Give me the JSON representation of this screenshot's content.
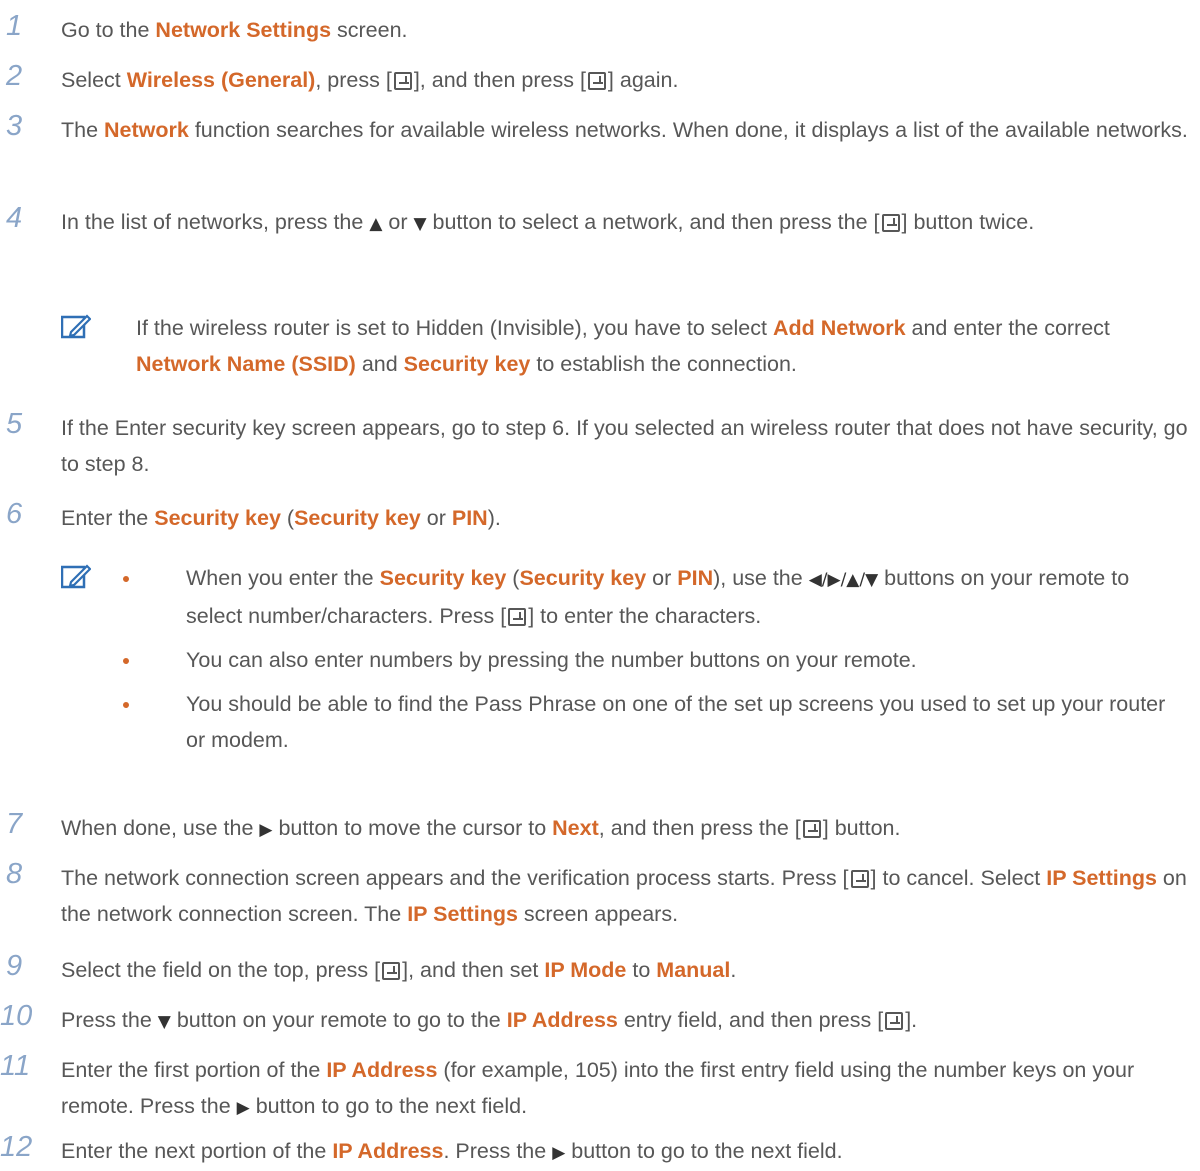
{
  "steps": [
    {
      "n": "1",
      "parts": [
        "Go to the ",
        "Network Settings",
        " screen."
      ]
    },
    {
      "n": "2",
      "parts": [
        "Select ",
        "Wireless (General)",
        ", press [",
        "], and then press [",
        "] again."
      ]
    },
    {
      "n": "3",
      "parts": [
        "The ",
        "Network",
        " function searches for available wireless networks. When done, it displays a list of the available networks."
      ]
    },
    {
      "n": "4",
      "parts": [
        "In the list of networks, press the ",
        "▲",
        " or ",
        "▼",
        " button to select a network, and then press the [",
        "] button twice."
      ]
    },
    {
      "n": "5",
      "parts": [
        "If the Enter security key screen appears, go to step 6. If you selected an wireless router that does not have security, go to step 8."
      ]
    },
    {
      "n": "6",
      "parts": [
        "Enter the ",
        "Security key",
        " (",
        "Security key",
        " or ",
        "PIN",
        ")."
      ]
    },
    {
      "n": "7",
      "parts": [
        "When done, use the ",
        "▶",
        " button to move the cursor to ",
        "Next",
        ", and then press the [",
        "] button."
      ]
    },
    {
      "n": "8",
      "parts": [
        "The network connection screen appears and the verification process starts. Press [",
        "] to cancel. Select ",
        "IP Settings",
        " on the network connection screen. The ",
        "IP Settings",
        " screen appears."
      ]
    },
    {
      "n": "9",
      "parts": [
        "Select the field on the top, press [",
        "], and then set ",
        "IP Mode",
        " to ",
        "Manual",
        "."
      ]
    },
    {
      "n": "10",
      "parts": [
        "Press the ",
        "▼",
        " button on your remote to go to the ",
        "IP Address",
        " entry field, and then press [",
        "]."
      ]
    },
    {
      "n": "11",
      "parts": [
        "Enter the first portion of the ",
        "IP Address",
        " (for example, 105) into the first entry field using the number keys on your remote. Press the ",
        "▶",
        " button to go to the next field."
      ]
    },
    {
      "n": "12",
      "parts": [
        "Enter the next portion of the ",
        "IP Address",
        ". Press the ",
        "▶",
        " button to go to the next field."
      ]
    }
  ],
  "note1": {
    "parts": [
      "If the wireless router is set to Hidden (Invisible), you have to select ",
      "Add Network",
      " and enter the correct ",
      "Network Name (SSID)",
      " and ",
      "Security key",
      " to establish the connection."
    ]
  },
  "note2": {
    "bullets": [
      {
        "parts": [
          "When you enter the ",
          "Security key",
          " (",
          "Security key",
          " or ",
          "PIN",
          "), use the ",
          "◀/▶/▲/▼",
          " buttons on your remote to select number/characters. Press [",
          "] to enter the characters."
        ]
      },
      {
        "parts": [
          "You can also enter numbers by pressing the number buttons on your remote."
        ]
      },
      {
        "parts": [
          "You should be able to find the Pass Phrase on one of the set up screens you used to set up your router or modem."
        ]
      }
    ]
  },
  "colors": {
    "highlight": "#d4682a",
    "step_number": "#8aa5c8",
    "body_text": "#575757",
    "note_icon": "#2f6fb5"
  },
  "icons": {
    "enter_key": "enter-key-icon",
    "note": "note-pencil-icon"
  }
}
